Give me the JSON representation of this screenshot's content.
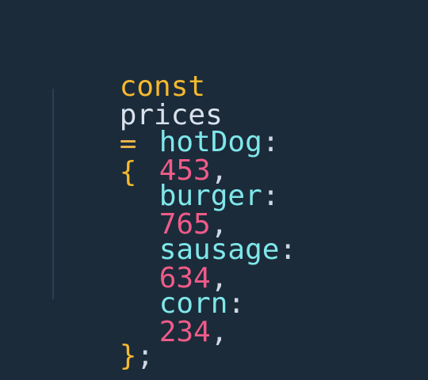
{
  "code": {
    "line1": {
      "keyword": "const",
      "variable": "prices",
      "operator": "=",
      "open_brace": "{"
    },
    "entries": [
      {
        "key": "hotDog",
        "colon": ":",
        "value": "453",
        "comma": ","
      },
      {
        "key": "burger",
        "colon": ":",
        "value": "765",
        "comma": ","
      },
      {
        "key": "sausage",
        "colon": ":",
        "value": "634",
        "comma": ","
      },
      {
        "key": "corn",
        "colon": ":",
        "value": "234",
        "comma": ","
      }
    ],
    "closing": {
      "close_brace": "}",
      "semicolon": ";"
    }
  },
  "colors": {
    "background": "#1b2b3a",
    "keyword": "#f5b82e",
    "property": "#7fe7ea",
    "number": "#ef5b88",
    "text": "#cfd8e3"
  }
}
